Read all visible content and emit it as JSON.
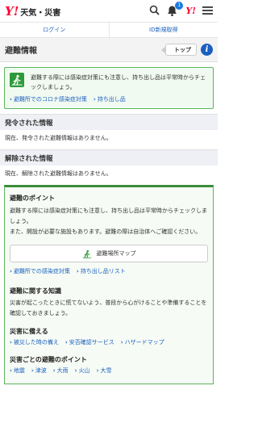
{
  "header": {
    "logo_mark": "Y!",
    "logo_text": "天気・災害",
    "notification_count": "1",
    "yahoo_mark": "Y!"
  },
  "account": {
    "login": "ログイン",
    "register": "ID新規取得"
  },
  "page": {
    "title": "避難情報",
    "top_button": "トップ",
    "info_button": "i"
  },
  "covid": {
    "text": "避難する際には感染症対策にも注意し、持ち出し品は平常時からチェックしましょう。",
    "links": [
      "避難所でのコロナ感染症対策",
      "持ち出し品"
    ]
  },
  "issued": {
    "title": "発令された情報",
    "body": "現在、発令された避難情報はありません。"
  },
  "lifted": {
    "title": "解除された情報",
    "body": "現在、解除された避難情報はありません。"
  },
  "points": {
    "title": "避難のポイント",
    "text1": "避難する際には感染症対策にも注意し、持ち出し品は平常時からチェックしましょう。",
    "text2": "また、開設が必要な施設もあります。避難の際は自治体へご確認ください。",
    "map_button": "避難場所マップ",
    "links": [
      "避難所での感染症対策",
      "持ち出し品リスト"
    ]
  },
  "knowledge": {
    "title": "避難に関する知識",
    "text": "災害が起こったときに慌てないよう、普段から心がけることや準備することを確認しておきましょう。"
  },
  "prepare": {
    "title": "災害に備える",
    "links": [
      "被災した時の備え",
      "安否確認サービス",
      "ハザードマップ"
    ]
  },
  "by_disaster": {
    "title": "災害ごとの避難のポイント",
    "links": [
      "地震",
      "津波",
      "大雨",
      "火山",
      "大雪"
    ]
  },
  "colors": {
    "brand": "#ff0033",
    "link": "#1b60c0",
    "green": "#2e9a3a"
  }
}
